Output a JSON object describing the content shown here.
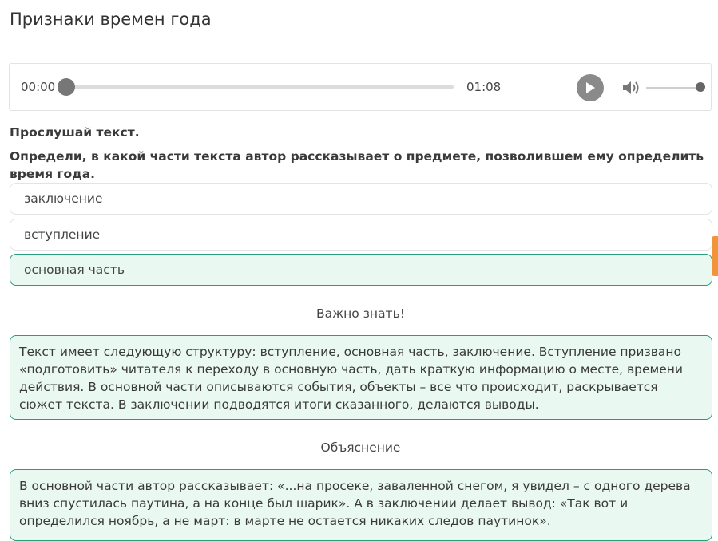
{
  "page": {
    "title": "Признаки времен года"
  },
  "player": {
    "current_time": "00:00",
    "duration": "01:08",
    "progress": 0,
    "volume": 1.0,
    "icons": {
      "play": "play-icon",
      "volume": "volume-icon"
    }
  },
  "instructions": {
    "listen": "Прослушай текст.",
    "question": "Определи, в какой части текста автор рассказывает о предмете, позволившем ему определить время года."
  },
  "options": [
    {
      "label": "заключение",
      "selected": false
    },
    {
      "label": "вступление",
      "selected": false
    },
    {
      "label": "основная часть",
      "selected": true
    }
  ],
  "important": {
    "heading": "Важно знать!",
    "text": "Текст имеет следующую структуру: вступление, основная часть, заключение. Вступление призвано «подготовить» читателя к переходу в основную часть, дать краткую информацию о месте, времени действия. В основной части описываются события, объекты – все что происходит, раскрывается сюжет текста. В заключении подводятся итоги сказанного, делаются выводы."
  },
  "explanation": {
    "heading": "Объяснение",
    "text": "В основной части автор рассказывает: «...на просеке, заваленной снегом, я увидел – с одного дерева вниз спустилась паутина, а на конце был шарик». А в заключении делает вывод: «Так вот и определился ноябрь, а не март: в марте не остается никаких следов паутинок»."
  },
  "colors": {
    "accent": "#2a9d7c",
    "selected_bg": "#eaf8f2",
    "side_tab": "#f0953a"
  }
}
